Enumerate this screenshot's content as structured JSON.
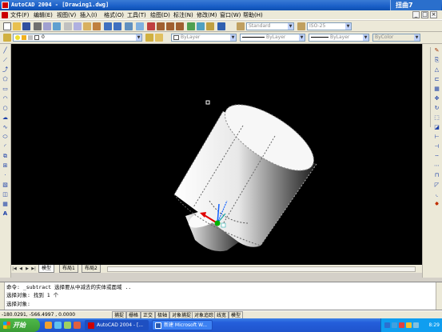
{
  "window": {
    "title": "AutoCAD 2004 - [Drawing1.dwg]",
    "capture_badge": "扭曲7"
  },
  "menu": {
    "items": [
      "文件(F)",
      "编辑(E)",
      "视图(V)",
      "插入(I)",
      "格式(O)",
      "工具(T)",
      "绘图(D)",
      "标注(N)",
      "修改(M)",
      "窗口(W)",
      "帮助(H)"
    ],
    "mdi_controls": [
      "_",
      "□",
      "×"
    ]
  },
  "toolbar": {
    "text_style": "Standard",
    "dim_style": "ISO-25",
    "layer": "0",
    "color": "ByLayer",
    "linetype": "ByLayer",
    "lineweight": "ByLayer",
    "plot_style": "ByColor"
  },
  "tabs": {
    "items": [
      "模型",
      "布局1",
      "布局2"
    ],
    "active": "模型"
  },
  "command": {
    "lines": [
      "命令: _subtract 选择要从中减去的实体或面域 ..",
      "选择对象: 找到 1 个",
      "选择对象:"
    ]
  },
  "status": {
    "coords": "-180.0291, -566.4997 , 0.0000",
    "buttons": [
      "捕捉",
      "栅格",
      "正交",
      "极轴",
      "对象捕捉",
      "对象追踪",
      "线宽",
      "模型"
    ]
  },
  "taskbar": {
    "start_label": "开始",
    "tasks": [
      {
        "label": "AutoCAD 2004 - [...",
        "active": true
      },
      {
        "label": "新建 Microsoft W...",
        "active": false
      }
    ],
    "clock": "8:29"
  },
  "colors": {
    "canvas": "#000000",
    "title_bar": "#1a5fc8",
    "taskbar": "#245edb",
    "ucs_x": "#e00000",
    "ucs_y": "#00b000",
    "ucs_z": "#1060ff"
  }
}
